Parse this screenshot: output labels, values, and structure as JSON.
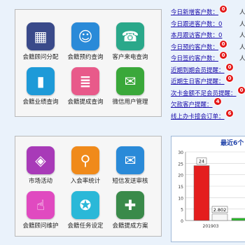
{
  "top_panel": {
    "tiles": [
      {
        "label": "会籍顾问分配",
        "icon": "qr-code-icon",
        "color": "#3a4a8a"
      },
      {
        "label": "会籍预约查询",
        "icon": "user-search-icon",
        "color": "#2a8ad8"
      },
      {
        "label": "客户来电查询",
        "icon": "phone-icon",
        "color": "#2aa88a"
      },
      {
        "label": "会籍业绩查询",
        "icon": "bar-chart-icon",
        "color": "#1e9ad8"
      },
      {
        "label": "会籍提成查询",
        "icon": "stack-icon",
        "color": "#e85a8a"
      },
      {
        "label": "微信用户管理",
        "icon": "wechat-icon",
        "color": "#3aa83a"
      }
    ]
  },
  "bottom_panel": {
    "tiles": [
      {
        "label": "市场活动",
        "icon": "shopping-bag-icon",
        "color": "#a83ab8"
      },
      {
        "label": "入会率统计",
        "icon": "magnifier-icon",
        "color": "#f08a1a"
      },
      {
        "label": "短信发送审核",
        "icon": "envelope-icon",
        "color": "#2a8ad8"
      },
      {
        "label": "会籍顾问维护",
        "icon": "hand-icon",
        "color": "#e04ac0"
      },
      {
        "label": "会籍任务设定",
        "icon": "award-icon",
        "color": "#2ab8d8"
      },
      {
        "label": "会籍提成方案",
        "icon": "tools-icon",
        "color": "#3a8a4a"
      }
    ]
  },
  "links": [
    {
      "text": "今日新增客户数：",
      "badge": "0",
      "person": "人"
    },
    {
      "text": "今日跟进客户数：0",
      "badge": "",
      "person": "人"
    },
    {
      "text": "本月跟访客户数：0",
      "badge": "",
      "person": "人"
    },
    {
      "text": "今日预约客户数：",
      "badge": "0",
      "person": "人"
    },
    {
      "text": "今日签约客户数：",
      "badge": "0",
      "person": "人"
    },
    {
      "text": "近期到期会员提醒：",
      "badge": "0",
      "person": ""
    },
    {
      "text": "近期生日客户提醒：",
      "badge": "0",
      "person": ""
    },
    {
      "text": "次卡金额不足会员提醒：",
      "badge": "0",
      "person": ""
    },
    {
      "text": "欠款客户提醒：",
      "badge": "4",
      "person": ""
    },
    {
      "text": "线上办卡接会订单：",
      "badge": "6",
      "person": ""
    }
  ],
  "chart": {
    "title": "最近6个",
    "chart_data": {
      "type": "bar",
      "categories": [
        "201903",
        ""
      ],
      "series": [
        {
          "values": [
            24,
            null
          ]
        },
        {
          "values": [
            2.802,
            null
          ]
        },
        {
          "values": [
            null,
            1
          ]
        }
      ],
      "data_labels": [
        "24",
        "2.802"
      ],
      "y_ticks": [
        0,
        5,
        10,
        15,
        20,
        25,
        30
      ],
      "ylim": [
        0,
        30
      ],
      "grid": true,
      "colors": [
        "#e41e1e",
        "#ffffff",
        "#2ab82a"
      ]
    }
  }
}
